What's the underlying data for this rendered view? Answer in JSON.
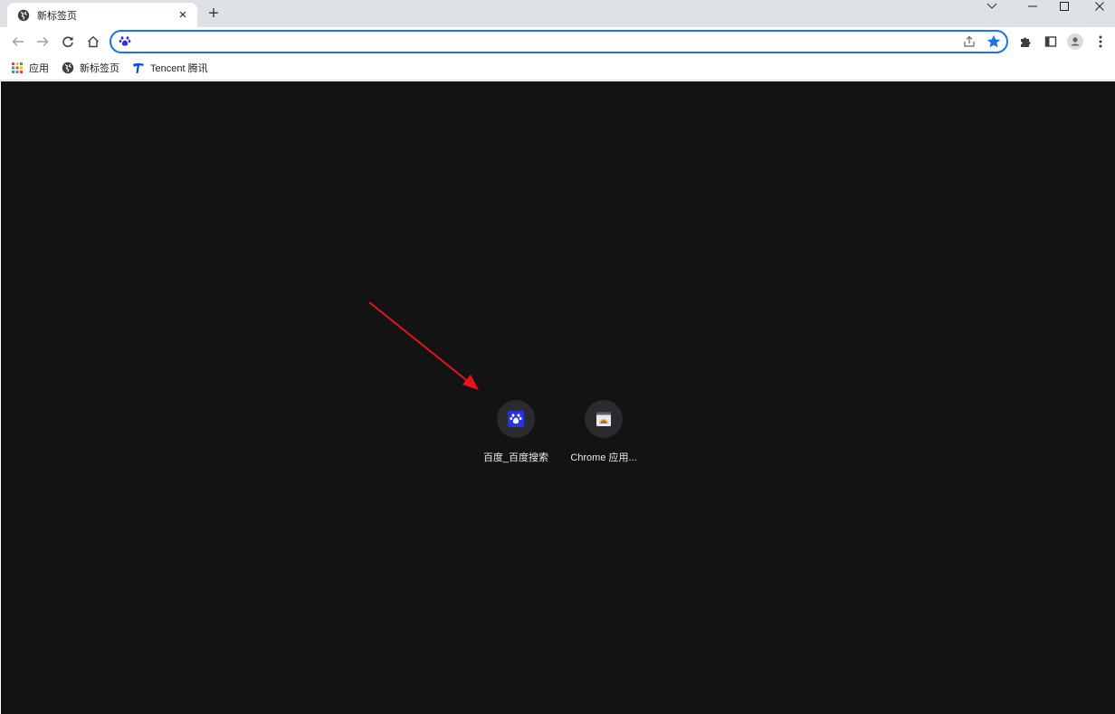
{
  "tab": {
    "title": "新标签页",
    "close_glyph": "×",
    "favicon": "globe-icon"
  },
  "newtab_glyph": "+",
  "window_controls": [
    "chevron-down-icon",
    "minimize-icon",
    "maximize-icon",
    "close-icon"
  ],
  "toolbar": {
    "address_value": "",
    "address_placeholder": "",
    "site_icon": "baidu-paw-icon",
    "accent_color": "#1a73e8"
  },
  "bookmarks": [
    {
      "label": "应用",
      "icon": "apps-grid-icon"
    },
    {
      "label": "新标签页",
      "icon": "globe-icon"
    },
    {
      "label": "Tencent 腾讯",
      "icon": "tencent-icon"
    }
  ],
  "shortcuts": [
    {
      "label": "百度_百度搜索",
      "icon": "baidu-paw-icon"
    },
    {
      "label": "Chrome 应用...",
      "icon": "chrome-web-store-icon"
    }
  ],
  "annotation": {
    "color": "#e8141b"
  },
  "colors": {
    "background": "#131313",
    "tile": "#2a2b2e",
    "tabstrip": "#dee1e6"
  }
}
